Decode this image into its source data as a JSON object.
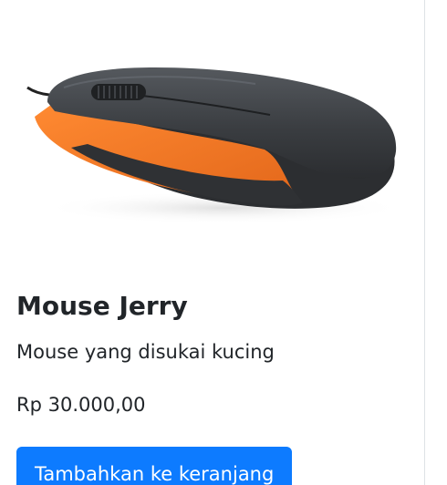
{
  "product": {
    "image_icon": "computer-mouse-icon",
    "name": "Mouse Jerry",
    "description": "Mouse yang disukai kucing",
    "price": "Rp 30.000,00",
    "add_to_cart_label": "Tambahkan ke keranjang"
  },
  "colors": {
    "button": "#0d7bff",
    "mouse_body": "#3a3d41",
    "mouse_accent": "#f07a22"
  }
}
